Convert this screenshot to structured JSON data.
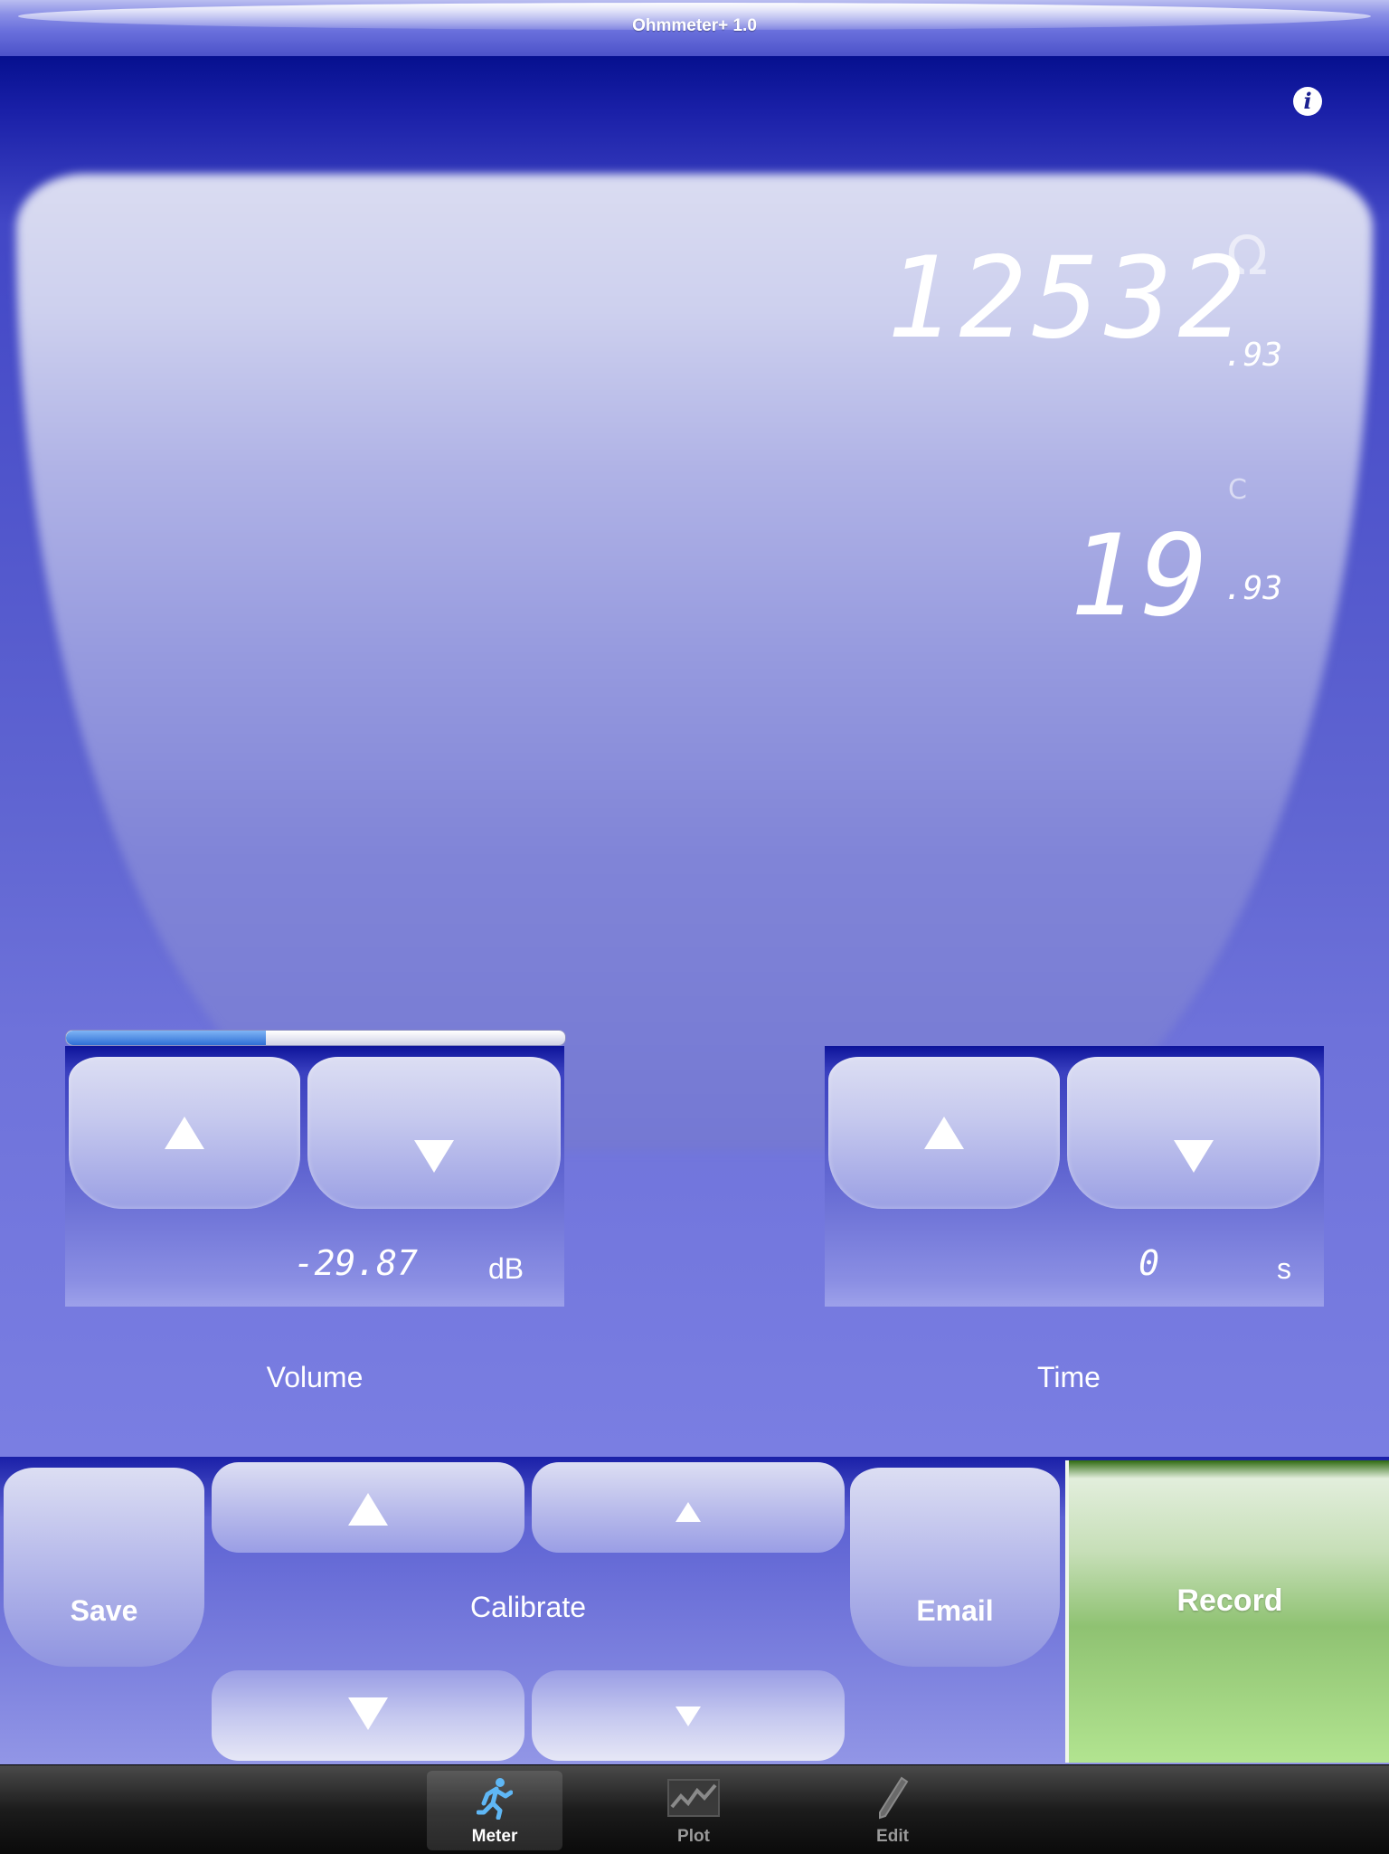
{
  "app": {
    "title": "Ohmmeter+ 1.0"
  },
  "display": {
    "resistance_main": "12532",
    "resistance_decimal": ".93",
    "resistance_unit": "Ω",
    "temperature_main": "19",
    "temperature_decimal": ".93",
    "temperature_unit": "C"
  },
  "volume": {
    "value": "-29.87",
    "unit": "dB",
    "caption": "Volume",
    "level_fraction": 0.4
  },
  "time": {
    "value": "0",
    "unit": "s",
    "caption": "Time"
  },
  "actions": {
    "save": "Save",
    "calibrate": "Calibrate",
    "email": "Email",
    "record": "Record"
  },
  "tabs": [
    {
      "label": "Meter",
      "icon": "running-man-icon",
      "selected": true
    },
    {
      "label": "Plot",
      "icon": "line-plot-icon",
      "selected": false
    },
    {
      "label": "Edit",
      "icon": "pencil-icon",
      "selected": false
    }
  ],
  "colors": {
    "background": "#5a5fd2",
    "record": "#8fc272",
    "progress": "#2f6fd6"
  }
}
